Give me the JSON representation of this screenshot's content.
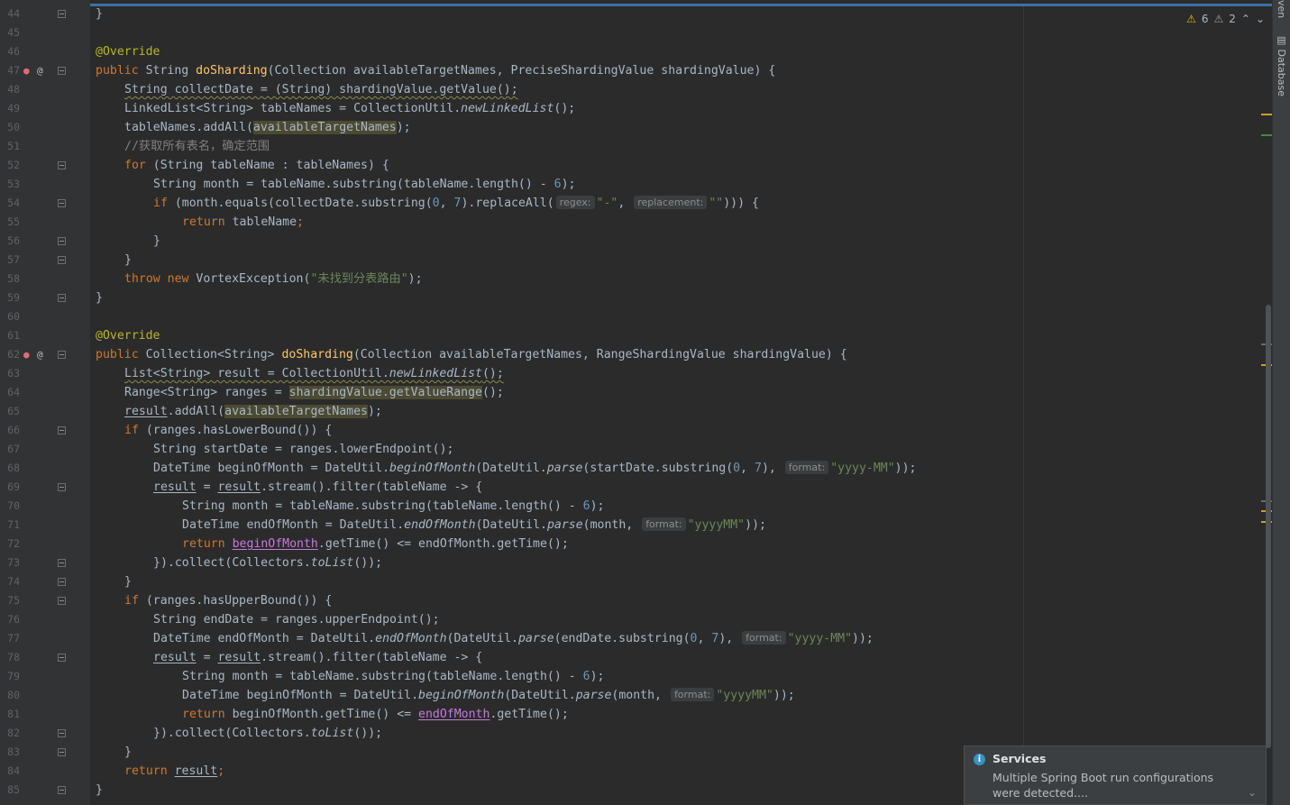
{
  "inspections": {
    "warnings": "6",
    "weak_warnings": "2"
  },
  "right_tool_window": {
    "label": "Database",
    "label_top": "ven"
  },
  "notification": {
    "title": "Services",
    "body": "Multiple Spring Boot run configurations were detected...."
  },
  "hints": {
    "regex": "regex:",
    "replacement": "replacement:",
    "format": "format:"
  },
  "lines": {
    "l44": "44",
    "l45": "45",
    "l46": "46",
    "l47": "47",
    "l48": "48",
    "l49": "49",
    "l50": "50",
    "l51": "51",
    "l52": "52",
    "l53": "53",
    "l54": "54",
    "l55": "55",
    "l56": "56",
    "l57": "57",
    "l58": "58",
    "l59": "59",
    "l60": "60",
    "l61": "61",
    "l62": "62",
    "l63": "63",
    "l64": "64",
    "l65": "65",
    "l66": "66",
    "l67": "67",
    "l68": "68",
    "l69": "69",
    "l70": "70",
    "l71": "71",
    "l72": "72",
    "l73": "73",
    "l74": "74",
    "l75": "75",
    "l76": "76",
    "l77": "77",
    "l78": "78",
    "l79": "79",
    "l80": "80",
    "l81": "81",
    "l82": "82",
    "l83": "83",
    "l84": "84",
    "l85": "85"
  },
  "code": {
    "c44": "}",
    "c46": "@Override",
    "c47_kw": "public",
    "c47_a": " String ",
    "c47_fn": "doSharding",
    "c47_b": "(Collection availableTargetNames, PreciseShardingValue shardingValue) {",
    "c48": "String collectDate = (String) shardingValue.getValue();",
    "c49_a": "LinkedList<String> tableNames = CollectionUtil.",
    "c49_m": "newLinkedList",
    "c49_b": "();",
    "c50_a": "tableNames.addAll(",
    "c50_h": "availableTargetNames",
    "c50_b": ");",
    "c51": "//获取所有表名，确定范围",
    "c52_kw": "for",
    "c52_a": " (String tableName : tableNames) {",
    "c53_a": "String month = tableName.substring(tableName.length() - ",
    "c53_n": "6",
    "c53_b": ");",
    "c54_kw": "if",
    "c54_a": " (month.equals(collectDate.substring(",
    "c54_n1": "0",
    "c54_s1": ", ",
    "c54_n2": "7",
    "c54_b": ").replaceAll(",
    "c54_str1": "\"-\"",
    "c54_c": ", ",
    "c54_str2": "\"\"",
    "c54_d": "))) {",
    "c55_kw": "return",
    "c55_a": " tableName",
    "c55_b": ";",
    "c56": "}",
    "c57": "}",
    "c58_kw1": "throw",
    "c58_kw2": " new",
    "c58_a": " VortexException(",
    "c58_str": "\"未找到分表路由\"",
    "c58_b": ");",
    "c59": "}",
    "c61": "@Override",
    "c62_kw": "public",
    "c62_a": " Collection<String> ",
    "c62_fn": "doSharding",
    "c62_b": "(Collection availableTargetNames, RangeShardingValue shardingValue) {",
    "c63_a": "List<String> result = CollectionUtil.",
    "c63_m": "newLinkedList",
    "c63_b": "();",
    "c64_a": "Range<String> ranges = ",
    "c64_h": "shardingValue.getValueRange",
    "c64_b": "();",
    "c65_u": "result",
    "c65_a": ".addAll(",
    "c65_h": "availableTargetNames",
    "c65_b": ");",
    "c66_kw": "if",
    "c66_a": " (ranges.hasLowerBound()) {",
    "c67": "String startDate = ranges.lowerEndpoint();",
    "c68_a": "DateTime beginOfMonth = DateUtil.",
    "c68_m1": "beginOfMonth",
    "c68_b": "(DateUtil.",
    "c68_m2": "parse",
    "c68_c": "(startDate.substring(",
    "c68_n1": "0",
    "c68_s": ", ",
    "c68_n2": "7",
    "c68_d": "), ",
    "c68_str": "\"yyyy-MM\"",
    "c68_e": "));",
    "c69_u1": "result",
    "c69_a": " = ",
    "c69_u2": "result",
    "c69_b": ".stream().filter(tableName -> {",
    "c70_a": "String month = tableName.substring(tableName.length() - ",
    "c70_n": "6",
    "c70_b": ");",
    "c71_a": "DateTime endOfMonth = DateUtil.",
    "c71_m1": "endOfMonth",
    "c71_b": "(DateUtil.",
    "c71_m2": "parse",
    "c71_c": "(month, ",
    "c71_str": "\"yyyyMM\"",
    "c71_d": "));",
    "c72_kw": "return",
    "c72_p": "beginOfMonth",
    "c72_a": ".getTime() <= endOfMonth.getTime();",
    "c73_a": "}).collect(Collectors.",
    "c73_m": "toList",
    "c73_b": "());",
    "c74": "}",
    "c75_kw": "if",
    "c75_a": " (ranges.hasUpperBound()) {",
    "c76": "String endDate = ranges.upperEndpoint();",
    "c77_a": "DateTime endOfMonth = DateUtil.",
    "c77_m1": "endOfMonth",
    "c77_b": "(DateUtil.",
    "c77_m2": "parse",
    "c77_c": "(endDate.substring(",
    "c77_n1": "0",
    "c77_s": ", ",
    "c77_n2": "7",
    "c77_d": "), ",
    "c77_str": "\"yyyy-MM\"",
    "c77_e": "));",
    "c78_u1": "result",
    "c78_a": " = ",
    "c78_u2": "result",
    "c78_b": ".stream().filter(tableName -> {",
    "c79_a": "String month = tableName.substring(tableName.length() - ",
    "c79_n": "6",
    "c79_b": ");",
    "c80_a": "DateTime beginOfMonth = DateUtil.",
    "c80_m1": "beginOfMonth",
    "c80_b": "(DateUtil.",
    "c80_m2": "parse",
    "c80_c": "(month, ",
    "c80_str": "\"yyyyMM\"",
    "c80_d": "));",
    "c81_kw": "return",
    "c81_a": " beginOfMonth.getTime() <= ",
    "c81_p": "endOfMonth",
    "c81_b": ".getTime();",
    "c82_a": "}).collect(Collectors.",
    "c82_m": "toList",
    "c82_b": "());",
    "c83": "}",
    "c84_kw": "return",
    "c84_u": "result",
    "c84_b": ";",
    "c85": "}"
  },
  "colors": {
    "accent": "#3d6fa8",
    "background": "#2b2b2b",
    "keyword": "#cc7832",
    "string": "#6a8759",
    "function": "#ffc66d"
  }
}
